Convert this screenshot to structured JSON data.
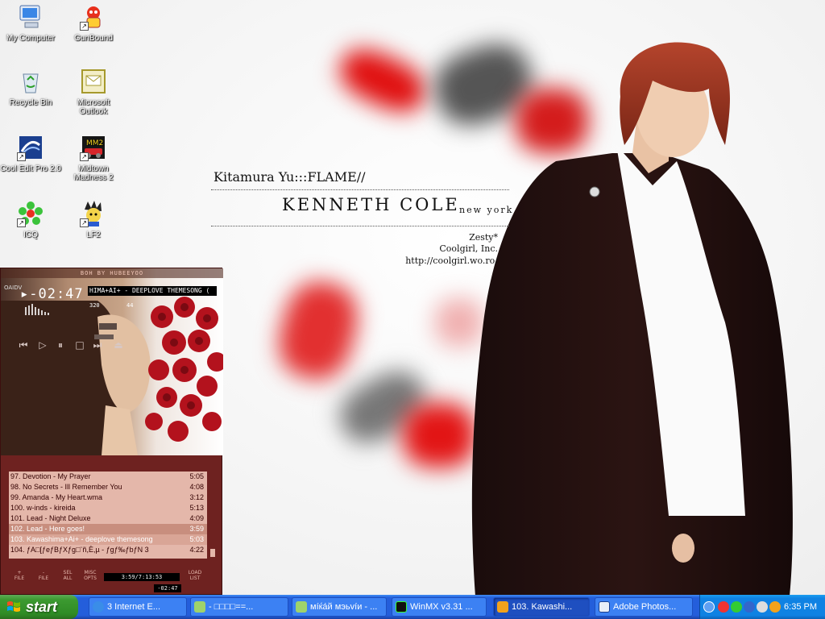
{
  "wallpaper": {
    "title": "Kitamura Yu:::FLAME//",
    "brand": "KENNETH COLE",
    "brand_sub": "new york",
    "credit_1": "Zesty*",
    "credit_2": "Coolgirl, Inc.",
    "credit_3": "http://coolgirl.wo.ro/"
  },
  "desktop_icons": [
    {
      "label": "My Computer",
      "icon": "computer-icon"
    },
    {
      "label": "GunBound",
      "icon": "gunbound-icon"
    },
    {
      "label": "Recycle Bin",
      "icon": "recycle-bin-icon"
    },
    {
      "label": "Microsoft Outlook",
      "icon": "outlook-icon"
    },
    {
      "label": "Cool Edit Pro 2.0",
      "icon": "cool-edit-icon"
    },
    {
      "label": "Midtown Madness 2",
      "icon": "midtown-madness-icon"
    },
    {
      "label": "ICQ",
      "icon": "icq-flower-icon"
    },
    {
      "label": "LF2",
      "icon": "lf2-icon"
    }
  ],
  "player": {
    "skin_title": "BOH BY HUBEEYOO",
    "time": "▸-02:47",
    "marquee": "HIMA+AI+ - DEEPLOVE THEMESONG (",
    "kbps": "320",
    "khz": "44",
    "side_label": "OAIDV",
    "controls": {
      "prev": "⏮",
      "play": "▷",
      "pause": "⏸",
      "stop": "□",
      "next": "⏭",
      "eject": "⏏"
    },
    "playlist": [
      {
        "title": "97. Devotion - My Prayer",
        "length": "5:05"
      },
      {
        "title": "98. No Secrets - Ill Remember You",
        "length": "4:08"
      },
      {
        "title": "99. Amanda - My Heart.wma",
        "length": "3:12"
      },
      {
        "title": "100. w-inds - kireida",
        "length": "5:13"
      },
      {
        "title": "101. Lead - Night Deluxe",
        "length": "4:09"
      },
      {
        "title": "102. Lead - Here goes!",
        "length": "3:59"
      },
      {
        "title": "103. Kawashima+Ai+ - deeplove themesong",
        "length": "5:03"
      },
      {
        "title": "104. ƒA□[ƒeƒBƒXƒg□¨ñ,È,µ - ƒgƒ‰ƒbƒN 3",
        "length": "4:22"
      }
    ],
    "bottom_buttons": [
      {
        "top": "+",
        "bottom": "FILE"
      },
      {
        "top": "-",
        "bottom": "FILE"
      },
      {
        "top": "SEL",
        "bottom": "ALL"
      },
      {
        "top": "MISC",
        "bottom": "OPTS"
      },
      {
        "top": "LOAD",
        "bottom": "LIST"
      }
    ],
    "total_time": "3:59/7:13:53",
    "small_time": "-02:47"
  },
  "taskbar": {
    "start_label": "start",
    "tasks": [
      {
        "label": "3 Internet E...",
        "icon": "internet-explorer-icon"
      },
      {
        "label": "- □□□□==...",
        "icon": "msn-icon"
      },
      {
        "label": "мíќáй мэьvíи - ...",
        "icon": "msn-icon"
      },
      {
        "label": "WinMX v3.31 ...",
        "icon": "winmx-icon"
      },
      {
        "label": "103. Kawashi...",
        "icon": "winamp-icon"
      },
      {
        "label": "Adobe Photos...",
        "icon": "photoshop-icon"
      }
    ],
    "clock": "6:35 PM"
  }
}
